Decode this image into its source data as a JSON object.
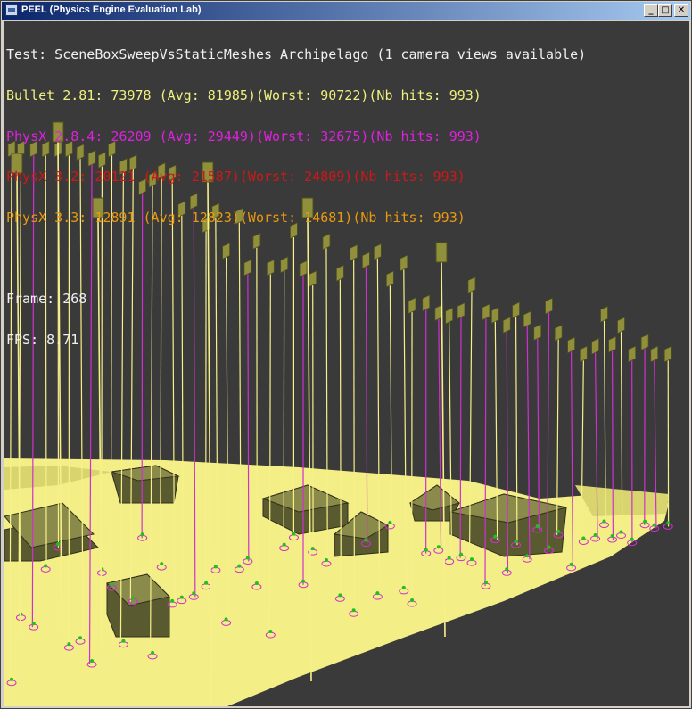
{
  "window": {
    "title": "PEEL (Physics Engine Evaluation Lab)",
    "controls": {
      "minimize": "_",
      "maximize": "□",
      "close": "✕"
    }
  },
  "hud": {
    "test_line": "Test: SceneBoxSweepVsStaticMeshes_Archipelago (1 camera views available)",
    "engines": [
      {
        "text": "Bullet 2.81: 73978 (Avg: 81985)(Worst: 90722)(Nb hits: 993)",
        "color": "#f0f080"
      },
      {
        "text": "PhysX 2.8.4: 26209 (Avg: 29449)(Worst: 32675)(Nb hits: 993)",
        "color": "#e020e0"
      },
      {
        "text": "PhysX 3.2: 20121 (Avg: 21587)(Worst: 24809)(Nb hits: 993)",
        "color": "#d01818"
      },
      {
        "text": "PhysX 3.3: 12891 (Avg: 12823)(Worst: 14681)(Nb hits: 993)",
        "color": "#e89a10"
      }
    ],
    "frame_line": "Frame: 268",
    "fps_line": "FPS: 8.71"
  },
  "colors": {
    "background": "#3a3a3a",
    "ground": "#f3ef86",
    "ground_shade": "#d8d46e",
    "building": "#8a8a4a",
    "building_dark": "#5a5a30",
    "sweep_line": "#f7f08a",
    "sweep_line_alt": "#d030d0",
    "box": "#8f8f3c",
    "hud_white": "#f0f0f0"
  }
}
